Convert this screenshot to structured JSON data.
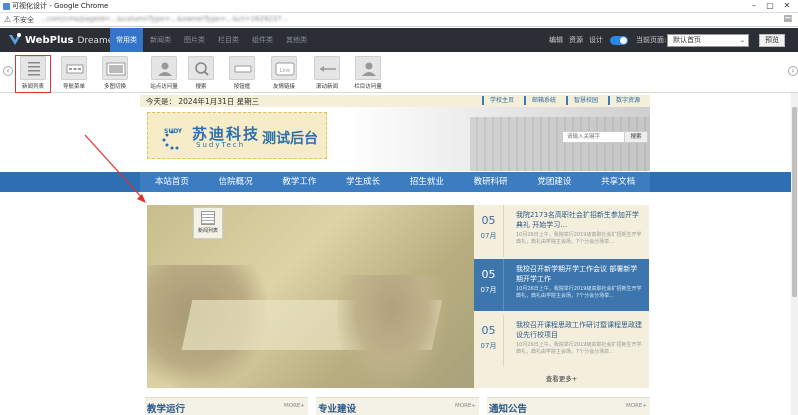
{
  "window": {
    "title": "可视化设计 - Google Chrome",
    "secure_label": "不安全",
    "url": "...com/cms/pageid=...&columnType=...&ownerType=...&ct=1629237...",
    "window_buttons": [
      "–",
      "▢",
      "✕"
    ]
  },
  "app": {
    "brand": "WebPlus",
    "brand_sub": "Dreamer",
    "tabs": [
      {
        "label": "常用类",
        "active": true
      },
      {
        "label": "新闻类"
      },
      {
        "label": "图片类"
      },
      {
        "label": "栏目类"
      },
      {
        "label": "组件类"
      },
      {
        "label": "其他类"
      }
    ],
    "right_links": [
      "编辑",
      "资源",
      "设计"
    ],
    "current_page_label": "当前页面:",
    "current_page_value": "默认首页",
    "preview_label": "预览"
  },
  "components": [
    {
      "label": "新闻列表",
      "icon": "news-list-icon",
      "selected": true
    },
    {
      "label": "导航菜单",
      "icon": "nav-menu-icon"
    },
    {
      "label": "多图切换",
      "icon": "image-slider-icon"
    },
    {
      "label": "站点访问量",
      "icon": "site-visits-icon"
    },
    {
      "label": "搜索",
      "icon": "search-icon"
    },
    {
      "label": "按钮框",
      "icon": "button-box-icon"
    },
    {
      "label": "友情链接",
      "icon": "friend-link-icon"
    },
    {
      "label": "滚动新闻",
      "icon": "scroll-news-icon"
    },
    {
      "label": "栏目访问量",
      "icon": "column-visits-icon"
    }
  ],
  "site": {
    "date": "今天是：  2024年1月31日 星期三",
    "quick_links": [
      "学校主页",
      "邮箱系统",
      "智慧校园",
      "数字资源"
    ],
    "logo_brand": "SUDY",
    "logo_cn": "苏迪科技",
    "logo_en": "SudyTech",
    "logo_suffix": "测试后台",
    "search_placeholder": "请输入关键字",
    "search_button": "搜索",
    "nav": [
      "本站首页",
      "信院概况",
      "教学工作",
      "学生成长",
      "招生就业",
      "教研科研",
      "党团建设",
      "共享文档"
    ],
    "drag_tag_label": "新闻列表",
    "news": [
      {
        "day": "05",
        "month": "07月",
        "title": "我院2173名高职社会扩招新生参加开学 典礼 开始学习…",
        "desc": "10月26日上午，我院举行2019级高职社会扩招新生开学典礼，典礼由学院主会场，7个分会分场举…",
        "active": false
      },
      {
        "day": "05",
        "month": "07月",
        "title": "我校召开新学期开学工作会议 部署新学期开学工作",
        "desc": "10月26日上午，我院举行2019级高职社会扩招新生开学典礼，典礼由学院主会场，7个分会分场举…",
        "active": true
      },
      {
        "day": "05",
        "month": "07月",
        "title": "我校召开课程思政工作研讨暨课程思政建设先行校项目",
        "desc": "10月26日上午，我院举行2019级高职社会扩招新生开学典礼，典礼由学院主会场，7个分会分场举…",
        "active": false
      }
    ],
    "news_more": "查看更多+",
    "sections": [
      {
        "title": "教学运行",
        "more": "MORE+"
      },
      {
        "title": "专业建设",
        "more": "MORE+"
      },
      {
        "title": "通知公告",
        "more": "MORE+"
      }
    ]
  },
  "colors": {
    "header_bg": "#2b2f35",
    "accent_blue": "#3275c9",
    "nav_blue": "#3b7dc0",
    "selection_red": "#e03030"
  }
}
